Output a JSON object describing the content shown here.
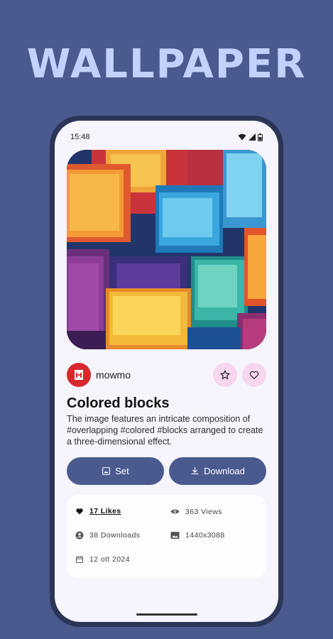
{
  "headline": "WALLPAPER",
  "status_bar": {
    "time": "15:48",
    "icons": [
      "wifi-icon",
      "signal-icon",
      "battery-icon"
    ]
  },
  "wallpaper": {
    "title": "Colored blocks",
    "description": "The image features an intricate composition of #overlapping #colored #blocks arranged to create a three-dimensional effect.",
    "author": {
      "name": "mowmo",
      "avatar_icon": "mowmo-logo-icon",
      "avatar_color": "#d8282d"
    },
    "actions": {
      "set_label": "Set",
      "download_label": "Download"
    },
    "stats": {
      "likes": "17 Likes",
      "views": "363 Views",
      "downloads": "38 Downloads",
      "resolution": "1440x3088",
      "date": "12 ott 2024"
    }
  },
  "colors": {
    "background": "#4a5a8f",
    "headline": "#c2d1ff",
    "screen": "#f6f4fd",
    "accent_button": "#4a5a8f",
    "round_button": "#f8d6ee"
  }
}
